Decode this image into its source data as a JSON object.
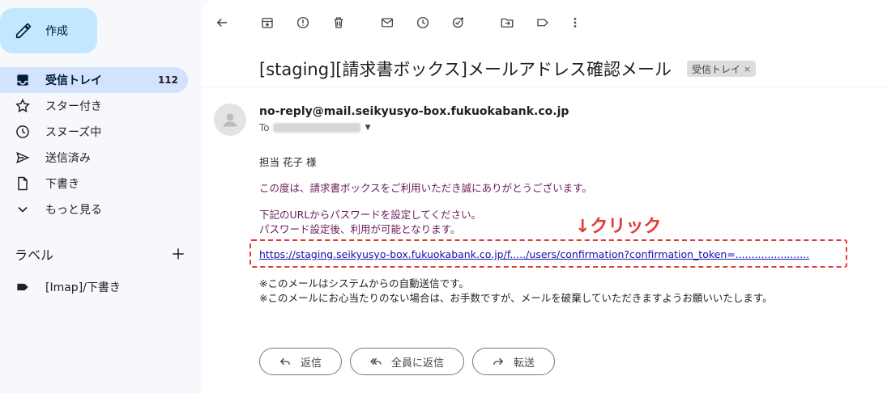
{
  "compose": {
    "label": "作成",
    "icon": "pencil-icon"
  },
  "nav": [
    {
      "label": "受信トレイ",
      "count": "112",
      "icon": "inbox-icon",
      "active": true
    },
    {
      "label": "スター付き",
      "count": "",
      "icon": "star-icon"
    },
    {
      "label": "スヌーズ中",
      "count": "",
      "icon": "clock-icon"
    },
    {
      "label": "送信済み",
      "count": "",
      "icon": "send-icon"
    },
    {
      "label": "下書き",
      "count": "",
      "icon": "file-icon"
    },
    {
      "label": "もっと見る",
      "count": "",
      "icon": "chevron-down-icon"
    }
  ],
  "labels": {
    "heading": "ラベル",
    "items": [
      {
        "label": "[Imap]/下書き",
        "icon": "label-tag-icon"
      }
    ]
  },
  "email": {
    "subject": "[staging][請求書ボックス]メールアドレス確認メール",
    "chip": "受信トレイ",
    "chip_close": "×",
    "sender": "no-reply@mail.seikyusyo-box.fukuokabank.co.jp",
    "to_label": "To",
    "greeting": "担当 花子 様",
    "line1": "この度は、請求書ボックスをご利用いただき誠にありがとうございます。",
    "line2": "下記のURLからパスワードを設定してください。",
    "line3": "パスワード設定後、利用が可能となります。",
    "link": "https://staging.seikyusyo-box.fukuokabank.co.jp/f...../users/confirmation?confirmation_token=.......................",
    "note1": "※このメールはシステムからの自動送信です。",
    "note2": "※このメールにお心当たりのない場合は、お手数ですが、メールを破棄していただきますようお願いいたします。",
    "annotation": "↓クリック"
  },
  "actions": [
    {
      "label": "返信",
      "icon": "reply-icon"
    },
    {
      "label": "全員に返信",
      "icon": "reply-all-icon"
    },
    {
      "label": "転送",
      "icon": "forward-icon"
    }
  ],
  "colors": {
    "active_bg": "#d3e3fd",
    "compose_bg": "#c2e7ff",
    "highlight": "#e53935",
    "link": "#1a0dab"
  }
}
